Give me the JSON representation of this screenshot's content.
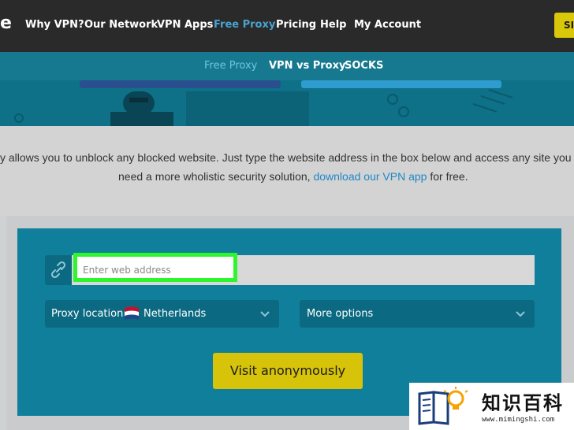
{
  "nav": {
    "logo_fragment": "e",
    "items": [
      "Why VPN?",
      "Our Network",
      "VPN Apps",
      "Free Proxy",
      "Pricing",
      "Help",
      "My Account"
    ],
    "signup_label": "SI"
  },
  "subnav": {
    "items": [
      "Free Proxy",
      "VPN vs Proxy",
      "SOCKS"
    ]
  },
  "intro": {
    "line1": "y allows you to unblock any blocked website. Just type the website address in the box below and access any site you w",
    "line2_prefix": "need a more wholistic security solution, ",
    "line2_link": "download our VPN app",
    "line2_suffix": " for free."
  },
  "proxy": {
    "url_placeholder": "Enter web address",
    "location_label": "Proxy location:",
    "location_value": "Netherlands",
    "more_options": "More options",
    "visit_button": "Visit anonymously"
  },
  "watermark": {
    "title": "知识百科",
    "url": "www.mimingshi.com"
  },
  "colors": {
    "accent": "#4aa3cf",
    "highlight": "#2ef52e",
    "button": "#d6c30a",
    "panel": "#0f7f9c"
  }
}
